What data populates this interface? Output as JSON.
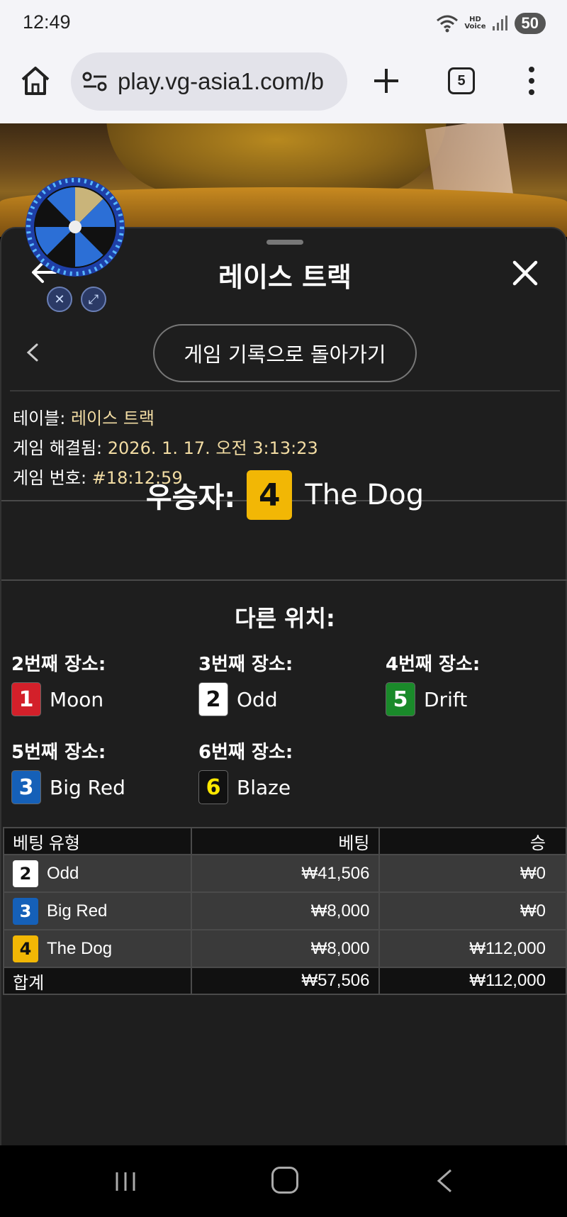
{
  "status_bar": {
    "time": "12:49",
    "hd_voice": "HD\nVoice",
    "battery": "50"
  },
  "browser": {
    "url": "play.vg-asia1.com/b",
    "tab_count": "5"
  },
  "panel": {
    "title": "레이스 트랙",
    "history_button": "게임 기록으로 돌아가기",
    "table_label": "테이블:",
    "table_value": "레이스 트랙",
    "resolved_label": "게임 해결됨:",
    "resolved_value": "2026. 1. 17. 오전 3:13:23",
    "game_no_label": "게임 번호:",
    "game_no_value": "#18:12:59"
  },
  "winner": {
    "label": "우승자:",
    "number": "4",
    "name": "The Dog",
    "color": "#f2b705"
  },
  "others": {
    "title": "다른 위치:",
    "places": [
      {
        "label": "2번째 장소:",
        "number": "1",
        "name": "Moon",
        "bg": "#d3202a",
        "fg": "#ffffff"
      },
      {
        "label": "3번째 장소:",
        "number": "2",
        "name": "Odd",
        "bg": "#ffffff",
        "fg": "#111111"
      },
      {
        "label": "4번째 장소:",
        "number": "5",
        "name": "Drift",
        "bg": "#1a8a2a",
        "fg": "#ffffff"
      },
      {
        "label": "5번째 장소:",
        "number": "3",
        "name": "Big Red",
        "bg": "#1560b8",
        "fg": "#ffffff"
      },
      {
        "label": "6번째 장소:",
        "number": "6",
        "name": "Blaze",
        "bg": "#111111",
        "fg": "#ffe800"
      }
    ]
  },
  "bets_table": {
    "headers": [
      "베팅 유형",
      "베팅",
      "승"
    ],
    "rows": [
      {
        "number": "2",
        "name": "Odd",
        "bet": "₩41,506",
        "win": "₩0",
        "bg": "#ffffff",
        "fg": "#111111"
      },
      {
        "number": "3",
        "name": "Big Red",
        "bet": "₩8,000",
        "win": "₩0",
        "bg": "#1560b8",
        "fg": "#ffffff"
      },
      {
        "number": "4",
        "name": "The Dog",
        "bet": "₩8,000",
        "win": "₩112,000",
        "bg": "#f2b705",
        "fg": "#111111"
      }
    ],
    "total": {
      "label": "합계",
      "bet": "₩57,506",
      "win": "₩112,000"
    }
  }
}
